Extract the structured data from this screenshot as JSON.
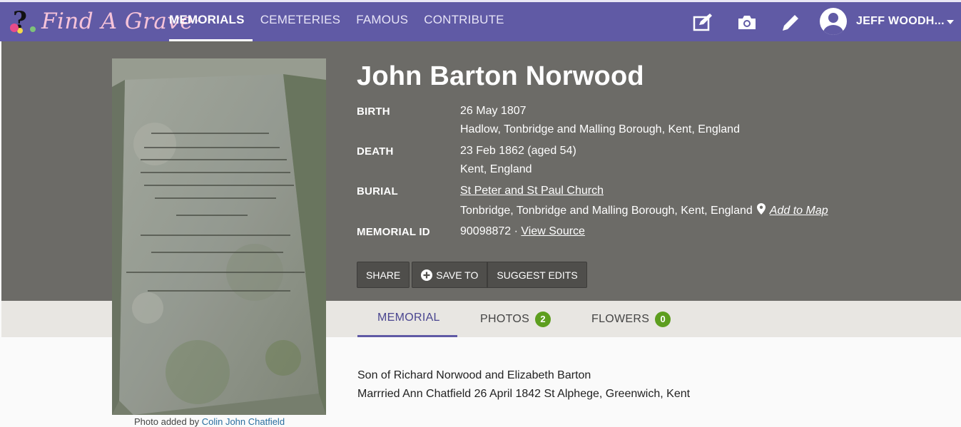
{
  "app": {
    "logo_text": "Find A Grave",
    "logo_tm": "™"
  },
  "nav": {
    "links": [
      "MEMORIALS",
      "CEMETERIES",
      "FAMOUS",
      "CONTRIBUTE"
    ],
    "icons": [
      "edit-note-icon",
      "camera-icon",
      "pencil-icon"
    ],
    "user_name": "JEFF WOODH..."
  },
  "memorial": {
    "name": "John Barton Norwood",
    "birth_label": "BIRTH",
    "birth_date": "26 May 1807",
    "birth_place": "Hadlow, Tonbridge and Malling Borough, Kent, England",
    "death_label": "DEATH",
    "death_date": "23 Feb 1862 (aged 54)",
    "death_place": "Kent, England",
    "burial_label": "BURIAL",
    "burial_cemetery": "St Peter and St Paul Church",
    "burial_place": "Tonbridge, Tonbridge and Malling Borough, Kent, England",
    "add_to_map": "Add to Map",
    "memorial_id_label": "MEMORIAL ID",
    "memorial_id": "90098872",
    "id_separator": " · ",
    "view_source": "View Source"
  },
  "buttons": {
    "share": "SHARE",
    "save_to": "SAVE TO",
    "suggest_edits": "SUGGEST EDITS"
  },
  "tabs": {
    "memorial": "MEMORIAL",
    "photos": "PHOTOS",
    "photos_count": "2",
    "flowers": "FLOWERS",
    "flowers_count": "0"
  },
  "photo": {
    "caption_prefix": "Photo added by ",
    "caption_author": "Colin John Chatfield"
  },
  "bio": {
    "line1": "Son of Richard Norwood and Elizabeth Barton",
    "line2": "Marrried Ann Chatfield 26 April 1842 St Alphege, Greenwich, Kent"
  },
  "colors": {
    "nav_bg": "#605aa5",
    "hero_bg": "#6c6b67",
    "tab_band_bg": "#e8e6e2",
    "badge_green": "#5d9e1f",
    "link_blue": "#2a6fa0"
  }
}
